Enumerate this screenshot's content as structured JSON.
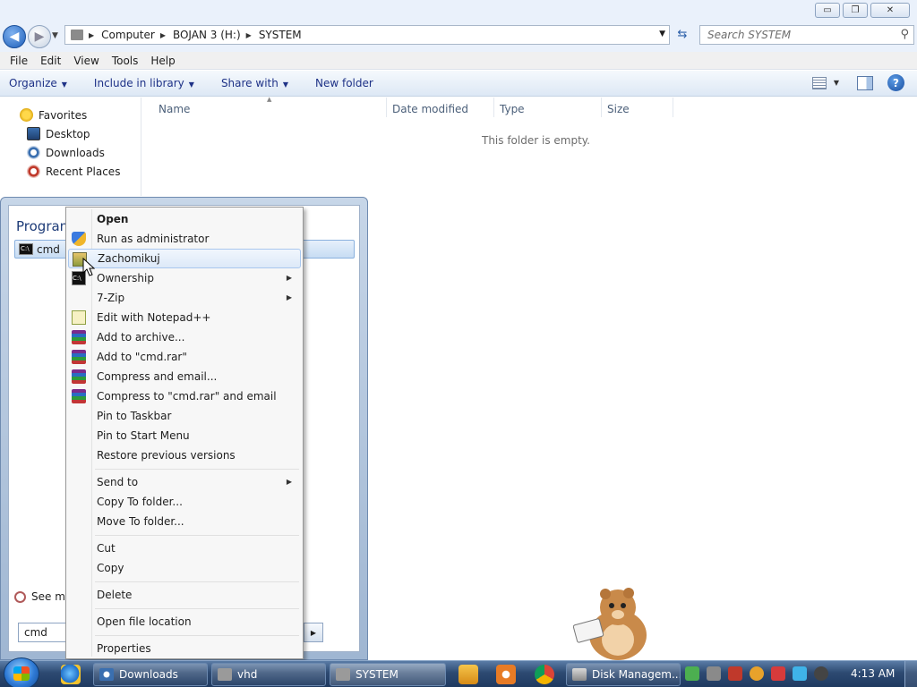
{
  "window": {
    "min": "▭",
    "restore": "❐",
    "close": "✕"
  },
  "address": {
    "back": "◀",
    "forward": "▶",
    "crumbs": [
      "Computer",
      "BOJAN 3 (H:)",
      "SYSTEM"
    ],
    "search_placeholder": "Search SYSTEM"
  },
  "menubar": [
    "File",
    "Edit",
    "View",
    "Tools",
    "Help"
  ],
  "commandbar": {
    "organize": "Organize",
    "include": "Include in library",
    "share": "Share with",
    "new_folder": "New folder",
    "help": "?"
  },
  "navpane": {
    "favorites": "Favorites",
    "items": [
      "Desktop",
      "Downloads",
      "Recent Places"
    ]
  },
  "columns": [
    "Name",
    "Date modified",
    "Type",
    "Size"
  ],
  "empty_message": "This folder is empty.",
  "startmenu": {
    "programs_title": "Programs (1)",
    "result": "cmd",
    "see_more": "See more results",
    "search_value": "cmd"
  },
  "context_menu": {
    "items": [
      {
        "label": "Open"
      },
      {
        "label": "Run as administrator"
      },
      {
        "label": "Zachomikuj"
      },
      {
        "label": "Ownership",
        "arrow": "▶"
      },
      {
        "label": "7-Zip",
        "arrow": "▶"
      },
      {
        "label": "Edit with Notepad++"
      },
      {
        "label": "Add to archive..."
      },
      {
        "label": "Add to \"cmd.rar\""
      },
      {
        "label": "Compress and email..."
      },
      {
        "label": "Compress to \"cmd.rar\" and email"
      },
      {
        "label": "Pin to Taskbar"
      },
      {
        "label": "Pin to Start Menu"
      },
      {
        "label": "Restore previous versions"
      },
      {
        "label": "Send to",
        "arrow": "▶"
      },
      {
        "label": "Copy To folder..."
      },
      {
        "label": "Move To folder..."
      },
      {
        "label": "Cut"
      },
      {
        "label": "Copy"
      },
      {
        "label": "Delete"
      },
      {
        "label": "Open file location"
      },
      {
        "label": "Properties"
      }
    ]
  },
  "taskbar": {
    "buttons": [
      "Downloads",
      "vhd",
      "SYSTEM",
      "Disk Managem..."
    ],
    "clock": "4:13 AM"
  },
  "colors": {
    "accent": "#1e3287",
    "hover_border": "#a9c7ee",
    "taskbar": "#2d4a72"
  }
}
